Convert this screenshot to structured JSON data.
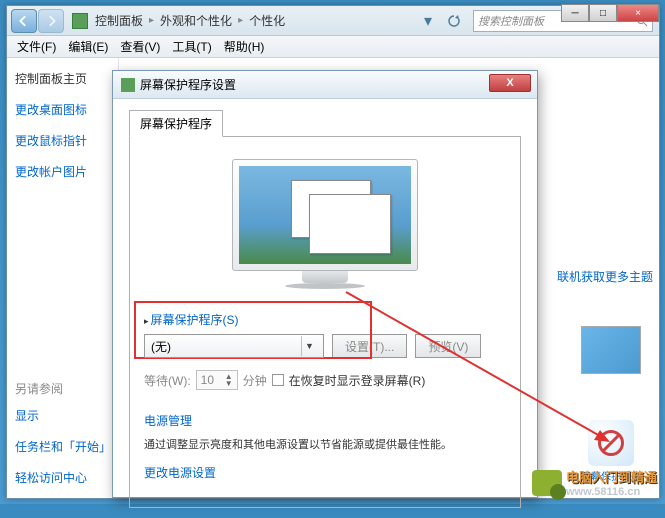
{
  "window": {
    "breadcrumb": [
      "控制面板",
      "外观和个性化",
      "个性化"
    ],
    "search_placeholder": "搜索控制面板",
    "menus": [
      {
        "label": "文件",
        "key": "(F)"
      },
      {
        "label": "编辑",
        "key": "(E)"
      },
      {
        "label": "查看",
        "key": "(V)"
      },
      {
        "label": "工具",
        "key": "(T)"
      },
      {
        "label": "帮助",
        "key": "(H)"
      }
    ]
  },
  "sidebar": {
    "main_link": "控制面板主页",
    "links": [
      "更改桌面图标",
      "更改鼠标指针",
      "更改帐户图片"
    ],
    "see_also_title": "另请参阅",
    "see_also": [
      "显示",
      "任务栏和「开始」",
      "轻松访问中心"
    ]
  },
  "right": {
    "online_link": "联机获取更多主题",
    "saver_label": "屏幕保护程序"
  },
  "dialog": {
    "title": "屏幕保护程序设置",
    "tab": "屏幕保护程序",
    "section_label": "屏幕保护程序(S)",
    "dropdown_value": "(无)",
    "btn_settings": "设置(T)...",
    "btn_preview": "预览(V)",
    "wait_label": "等待(W):",
    "wait_value": "10",
    "wait_unit": "分钟",
    "resume_checkbox": "在恢复时显示登录屏幕(R)",
    "power_title": "电源管理",
    "power_text": "通过调整显示亮度和其他电源设置以节省能源或提供最佳性能。",
    "power_link": "更改电源设置"
  },
  "watermark": {
    "line1": "电脑入门到精通",
    "line2": "www.58116.cn"
  }
}
